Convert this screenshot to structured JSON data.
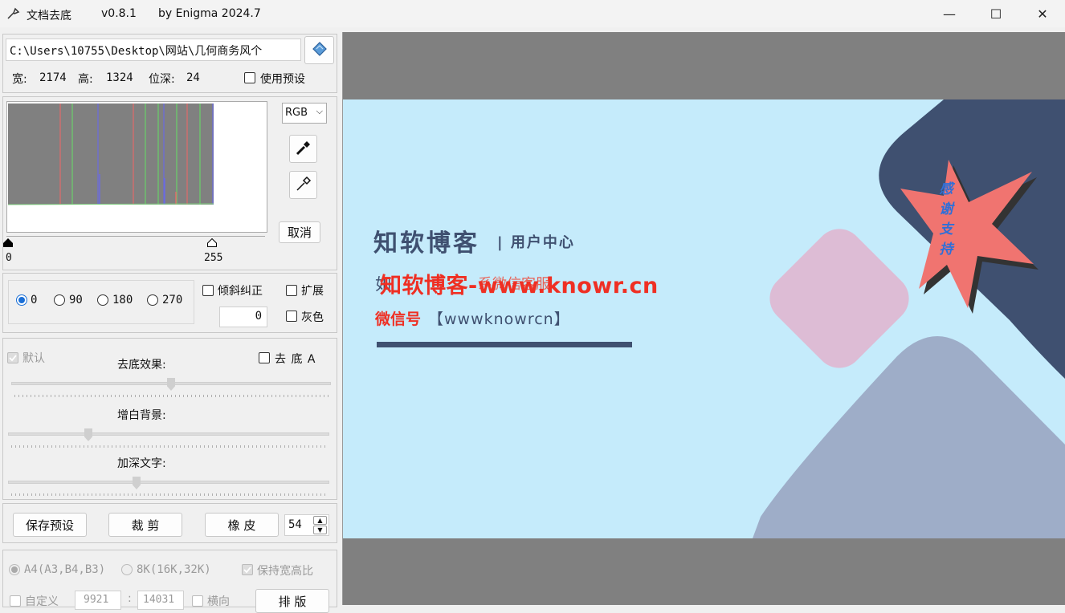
{
  "window": {
    "app_name": "文档去底",
    "version": "v0.8.1",
    "author": "by Enigma 2024.7",
    "minimize": "—",
    "maximize": "☐",
    "close": "✕"
  },
  "file": {
    "path": "C:\\Users\\10755\\Desktop\\网站\\几何商务风个",
    "width_label": "宽:",
    "width": "2174",
    "height_label": "高:",
    "height": "1324",
    "depth_label": "位深:",
    "depth": "24",
    "use_preset": "使用预设"
  },
  "histogram": {
    "channel": "RGB",
    "min": "0",
    "max": "255",
    "cancel": "取消"
  },
  "rotation": {
    "options": [
      "0",
      "90",
      "180",
      "270"
    ],
    "selected": "0",
    "deskew": "倾斜纠正",
    "expand": "扩展",
    "angle": "0",
    "gray": "灰色"
  },
  "effects": {
    "default": "默认",
    "remove_bg_label": "去底效果:",
    "remove_bg_a": "去 底 A",
    "whiten_label": "增白背景:",
    "darken_label": "加深文字:",
    "remove_bg_level": 0.5,
    "whiten_level": 0.25,
    "darken_level": 0.4
  },
  "actions": {
    "save_preset": "保存预设",
    "crop": "裁 剪",
    "eraser": "橡 皮",
    "eraser_size": "54"
  },
  "paper": {
    "a4": "A4(A3,B4,B3)",
    "k8": "8K(16K,32K)",
    "keep_ratio": "保持宽高比",
    "custom": "自定义",
    "custom_w": "9921",
    "sep": ":",
    "custom_h": "14031",
    "landscape": "横向",
    "layout": "排 版"
  },
  "preview": {
    "brand": "知软博客",
    "sub": "| 用户中心",
    "line_overlay": "知软博客-www.knowr.cn",
    "line_under_start": "如",
    "line_under_end": "系微信客服",
    "wechat_label": "微信号",
    "wechat_value": "【wwwknowrcn】",
    "badge": "感谢支持",
    "colors": {
      "bg": "#c5ebfb",
      "navy": "#3f5070",
      "pink": "#ddbcd5",
      "slate": "#9eadc8",
      "red": "#ef2f23",
      "star": "#f07470"
    }
  }
}
